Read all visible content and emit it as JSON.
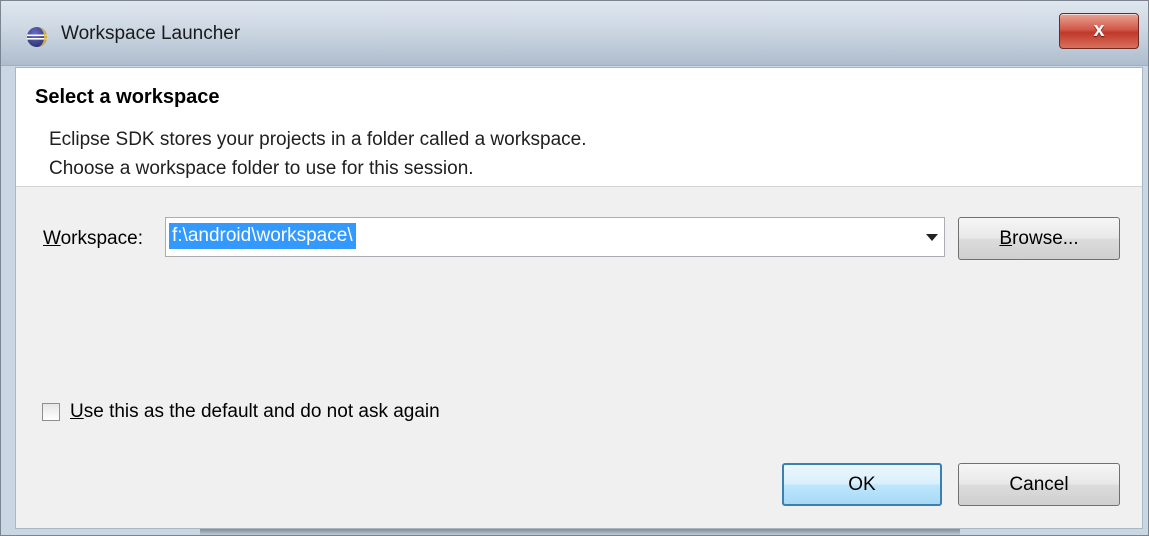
{
  "window": {
    "title": "Workspace Launcher",
    "close_label": "x"
  },
  "header": {
    "title": "Select a workspace",
    "description_line1": "Eclipse SDK stores your projects in a folder called a workspace.",
    "description_line2": "Choose a workspace folder to use for this session."
  },
  "workspace": {
    "label_mnemonic": "W",
    "label_rest": "orkspace:",
    "value": "f:\\android\\workspace\\"
  },
  "browse_button": {
    "mnemonic": "B",
    "label_rest": "rowse..."
  },
  "default_checkbox": {
    "mnemonic": "U",
    "label_rest": "se this as the default and do not ask again",
    "checked": false
  },
  "buttons": {
    "ok": "OK",
    "cancel": "Cancel"
  },
  "colors": {
    "selection_highlight": "#3399ff",
    "close_button": "#c0392b",
    "default_button_border": "#3c7fb1"
  }
}
